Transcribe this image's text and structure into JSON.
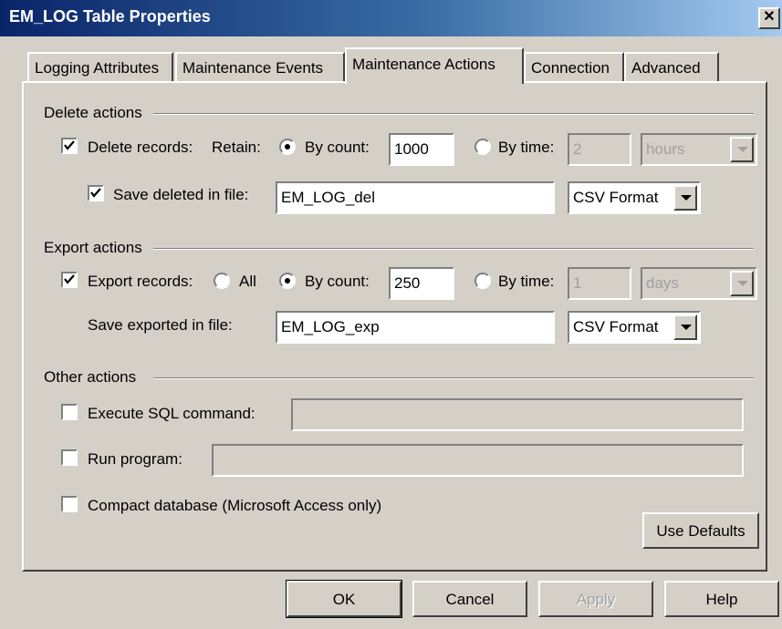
{
  "window": {
    "title": "EM_LOG Table Properties",
    "close_glyph": "✕"
  },
  "tabs": [
    {
      "label": "Logging Attributes"
    },
    {
      "label": "Maintenance Events"
    },
    {
      "label": "Maintenance Actions",
      "active": true
    },
    {
      "label": "Connection"
    },
    {
      "label": "Advanced"
    }
  ],
  "delete_actions": {
    "group_label": "Delete actions",
    "delete_records": {
      "label": "Delete records:",
      "checked": true
    },
    "retain_label": "Retain:",
    "by_count": {
      "label": "By count:",
      "selected": true,
      "value": "1000"
    },
    "by_time": {
      "label": "By time:",
      "selected": false,
      "value": "2",
      "unit": "hours"
    },
    "save_deleted": {
      "label": "Save deleted in file:",
      "checked": true,
      "filename": "EM_LOG_del",
      "format": "CSV Format"
    }
  },
  "export_actions": {
    "group_label": "Export actions",
    "export_records": {
      "label": "Export records:",
      "checked": true
    },
    "all": {
      "label": "All",
      "selected": false
    },
    "by_count": {
      "label": "By count:",
      "selected": true,
      "value": "250"
    },
    "by_time": {
      "label": "By time:",
      "selected": false,
      "value": "1",
      "unit": "days"
    },
    "save_exported": {
      "label": "Save exported in file:",
      "filename": "EM_LOG_exp",
      "format": "CSV Format"
    }
  },
  "other_actions": {
    "group_label": "Other actions",
    "execute_sql": {
      "label": "Execute SQL command:",
      "checked": false,
      "value": ""
    },
    "run_program": {
      "label": "Run program:",
      "checked": false,
      "value": ""
    },
    "compact_db": {
      "label": "Compact database (Microsoft Access only)",
      "checked": false
    }
  },
  "buttons": {
    "use_defaults": "Use Defaults",
    "ok": "OK",
    "cancel": "Cancel",
    "apply": "Apply",
    "help": "Help"
  },
  "colors": {
    "title_start": "#0a246a",
    "title_end": "#a6caf0",
    "face": "#d4d0c8"
  }
}
